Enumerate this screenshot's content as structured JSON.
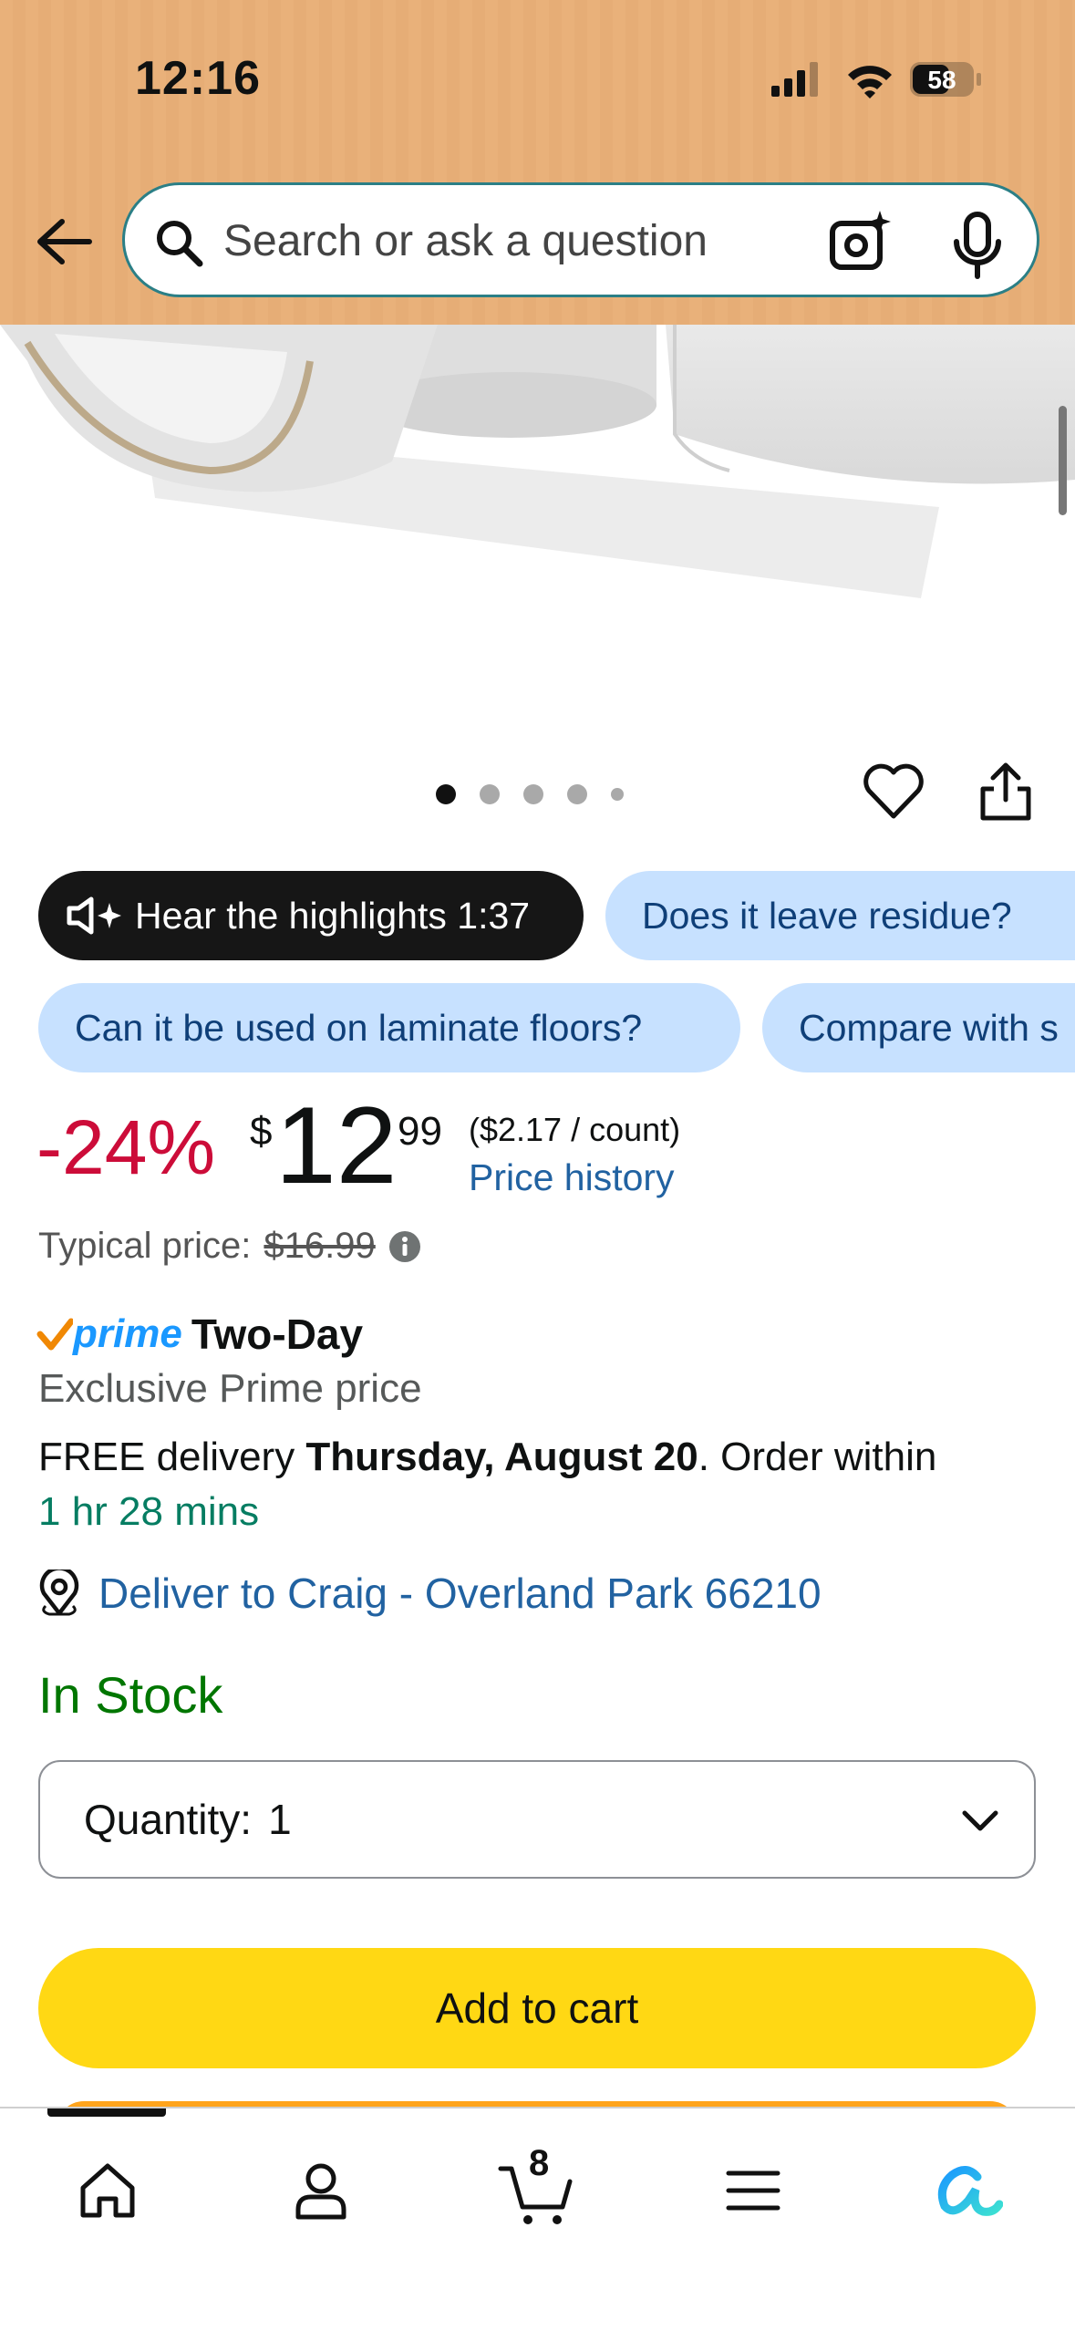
{
  "status_bar": {
    "time": "12:16",
    "battery": "58"
  },
  "search": {
    "placeholder": "Search or ask a question",
    "value": ""
  },
  "gallery": {
    "total_images": 5,
    "active_index": 0
  },
  "chips": {
    "highlights": "Hear the highlights 1:37",
    "questions": [
      "Does it leave residue?",
      "Can it be used on laminate floors?",
      "Compare with s"
    ]
  },
  "price": {
    "discount": "-24%",
    "currency": "$",
    "whole": "12",
    "fraction": "99",
    "unit": "($2.17 / count)",
    "history_link": "Price history",
    "typical_label": "Typical price:",
    "typical_value": "$16.99"
  },
  "prime": {
    "brand": "prime",
    "speed": "Two-Day",
    "exclusive": "Exclusive Prime price"
  },
  "delivery": {
    "prefix": "FREE delivery",
    "date": "Thursday, August 20",
    "middle": ". Order within",
    "countdown": "1 hr 28 mins",
    "deliver_to": "Deliver to Craig - Overland Park 66210"
  },
  "stock": "In Stock",
  "quantity": {
    "label": "Quantity:",
    "value": "1"
  },
  "add_to_cart": "Add to cart",
  "nav": {
    "cart_count": "8"
  },
  "colors": {
    "header": "#e9b17a",
    "discount": "#cc0c39",
    "link": "#2162a1",
    "in_stock": "#007600",
    "countdown": "#067d62",
    "add_to_cart": "#ffd814",
    "chip_blue": "#c7e1ff"
  }
}
